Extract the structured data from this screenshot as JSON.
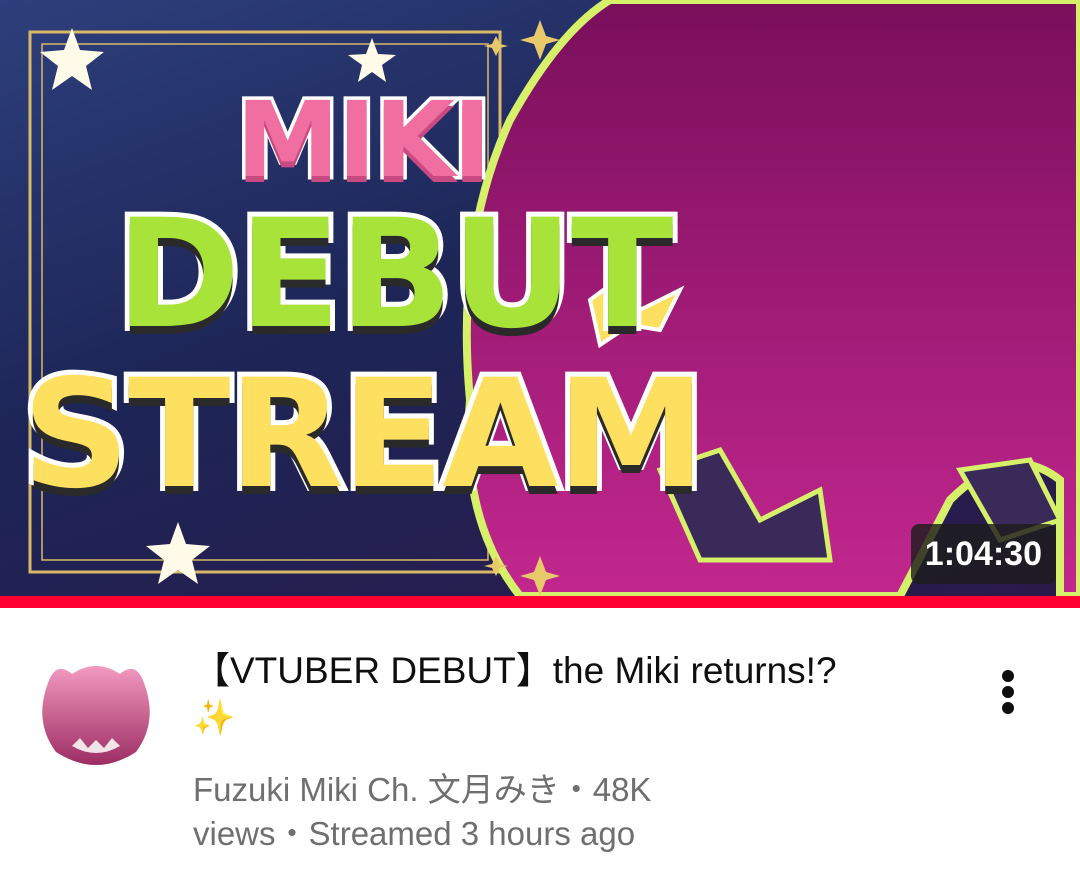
{
  "thumbnail": {
    "headline_top": "MIKI",
    "headline_mid": "DEBUT",
    "headline_bottom": "STREAM",
    "duration": "1:04:30",
    "colors": {
      "pink": "#f06fa0",
      "green": "#a8e33a",
      "yellow": "#fde060",
      "silhouette": "#8a1466"
    }
  },
  "progress": {
    "watched_fraction": 1.0,
    "color": "#ff0033"
  },
  "video": {
    "title_text": "【VTUBER DEBUT】the Miki returns!?",
    "title_emoji": "✨",
    "channel": "Fuzuki Miki Ch. 文月みき",
    "separator": "・",
    "views": "48K views",
    "streamed": "Streamed 3 hours ago"
  },
  "icons": {
    "avatar": "channel-avatar-pink-icon",
    "menu": "more-vertical-icon"
  }
}
